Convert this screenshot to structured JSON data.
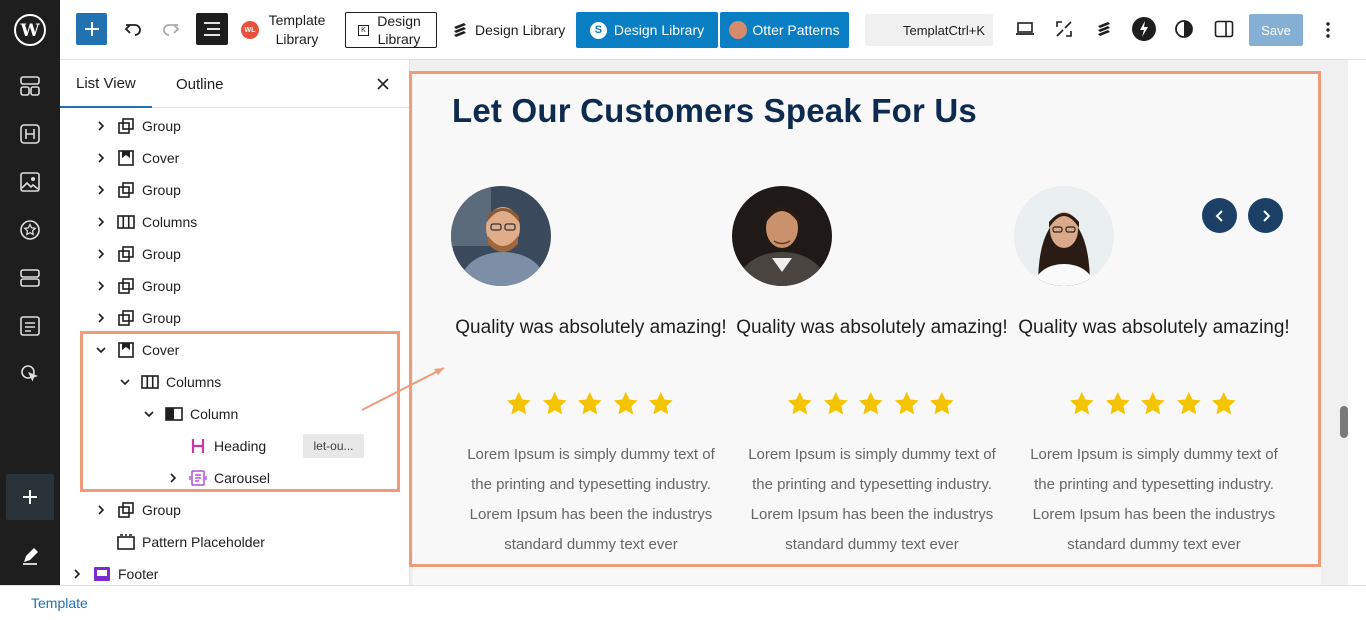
{
  "toolbar": {
    "template_library_label": "Template Library",
    "design_library_label_1": "Design Library",
    "design_library_label_2": "Design Library",
    "design_library_label_3": "Design Library",
    "otter_patterns_label": "Otter Patterns",
    "command_palette_text": "TemplatCtrl+K",
    "save_label": "Save",
    "accent_color": "#2271b1",
    "design_library_color": "#0a7ec2"
  },
  "sidebar": {
    "tabs": [
      {
        "label": "List View",
        "active": true
      },
      {
        "label": "Outline",
        "active": false
      }
    ],
    "rows": [
      {
        "label": "Group",
        "icon": "group-icon",
        "expanded": false
      },
      {
        "label": "Cover",
        "icon": "cover-icon",
        "expanded": false
      },
      {
        "label": "Group",
        "icon": "group-icon",
        "expanded": false
      },
      {
        "label": "Columns",
        "icon": "columns-icon",
        "expanded": false
      },
      {
        "label": "Group",
        "icon": "group-icon",
        "expanded": false
      },
      {
        "label": "Group",
        "icon": "group-icon",
        "expanded": false
      },
      {
        "label": "Group",
        "icon": "group-icon",
        "expanded": false
      },
      {
        "label": "Cover",
        "icon": "cover-icon",
        "expanded": true
      },
      {
        "label": "Columns",
        "icon": "columns-icon",
        "expanded": true
      },
      {
        "label": "Column",
        "icon": "column-icon",
        "expanded": true
      },
      {
        "label": "Heading",
        "icon": "heading-icon",
        "anchor": "let-ou..."
      },
      {
        "label": "Carousel",
        "icon": "carousel-icon",
        "expanded": false
      },
      {
        "label": "Group",
        "icon": "group-icon",
        "expanded": false
      },
      {
        "label": "Pattern Placeholder",
        "icon": "pattern-placeholder-icon"
      },
      {
        "label": "Footer",
        "icon": "footer-icon",
        "expanded": false
      }
    ]
  },
  "canvas": {
    "heading": "Let Our Customers Speak For Us",
    "cards": [
      {
        "title": "Quality was absolutely amazing!",
        "rating": 5,
        "body": "Lorem Ipsum is simply dummy text of the printing and typesetting industry. Lorem Ipsum has been the industrys standard dummy text ever"
      },
      {
        "title": "Quality was absolutely amazing!",
        "rating": 5,
        "body": "Lorem Ipsum is simply dummy text of the printing and typesetting industry. Lorem Ipsum has been the industrys standard dummy text ever"
      },
      {
        "title": "Quality was absolutely amazing!",
        "rating": 5,
        "body": "Lorem Ipsum is simply dummy text of the printing and typesetting industry. Lorem Ipsum has been the industrys standard dummy text ever"
      }
    ],
    "heading_color": "#0d2a4f",
    "star_color": "#f5c400",
    "nav_color": "#1c3f66",
    "highlight_color": "#ed9b79"
  },
  "footer": {
    "breadcrumb": "Template"
  }
}
